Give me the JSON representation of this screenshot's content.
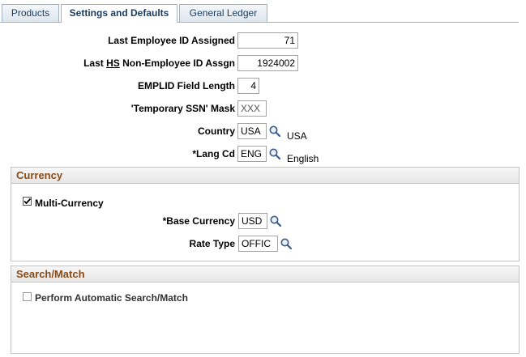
{
  "tabs": [
    {
      "label": "Products",
      "active": false
    },
    {
      "label": "Settings and Defaults",
      "active": true
    },
    {
      "label": "General Ledger",
      "active": false
    }
  ],
  "fields": {
    "last_employee_id": {
      "label": "Last Employee ID Assigned",
      "value": "71"
    },
    "last_hs_non_employee": {
      "label_pre": "Last ",
      "label_u": "HS",
      "label_post": " Non-Employee ID Assgn",
      "value": "1924002"
    },
    "emplid_field_length": {
      "label": "EMPLID Field Length",
      "value": "4"
    },
    "temp_ssn_mask": {
      "label": "'Temporary SSN' Mask",
      "value": "XXX"
    },
    "country": {
      "label": "Country",
      "value": "USA",
      "description": "USA"
    },
    "lang_cd": {
      "label": "*Lang Cd",
      "value": "ENG",
      "description": "English"
    }
  },
  "currency": {
    "title": "Currency",
    "multi_currency_label": "Multi-Currency",
    "multi_currency_checked": true,
    "base_currency": {
      "label": "*Base Currency",
      "value": "USD"
    },
    "rate_type": {
      "label": "Rate Type",
      "value": "OFFIC"
    }
  },
  "search_match": {
    "title": "Search/Match",
    "perform_label": "Perform Automatic Search/Match",
    "perform_checked": false
  },
  "icons": {
    "lookup": "magnifier-lookup-icon",
    "check": "checkmark-icon"
  },
  "colors": {
    "section_title": "#8a4b18",
    "tab_text": "#1b3b5c"
  }
}
